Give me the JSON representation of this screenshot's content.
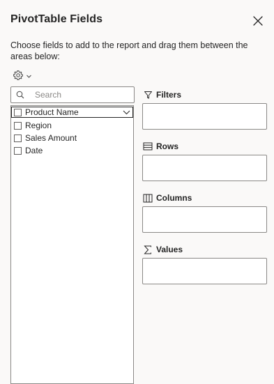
{
  "pane": {
    "title": "PivotTable Fields",
    "description": "Choose fields to add to the report and drag them between the areas below:",
    "close_icon": "close-icon",
    "settings_icon": "gear-icon"
  },
  "search": {
    "placeholder": "Search",
    "value": ""
  },
  "fields": [
    {
      "label": "Product Name",
      "checked": false,
      "focused": true
    },
    {
      "label": "Region",
      "checked": false
    },
    {
      "label": "Sales Amount",
      "checked": false
    },
    {
      "label": "Date",
      "checked": false
    }
  ],
  "areas": {
    "filters": {
      "label": "Filters",
      "icon": "filter-icon"
    },
    "rows": {
      "label": "Rows",
      "icon": "rows-icon"
    },
    "columns": {
      "label": "Columns",
      "icon": "columns-icon"
    },
    "values": {
      "label": "Values",
      "icon": "sigma-icon"
    }
  },
  "colors": {
    "pane_background": "#faf9f8",
    "text": "#242424",
    "border": "#8a8886"
  }
}
